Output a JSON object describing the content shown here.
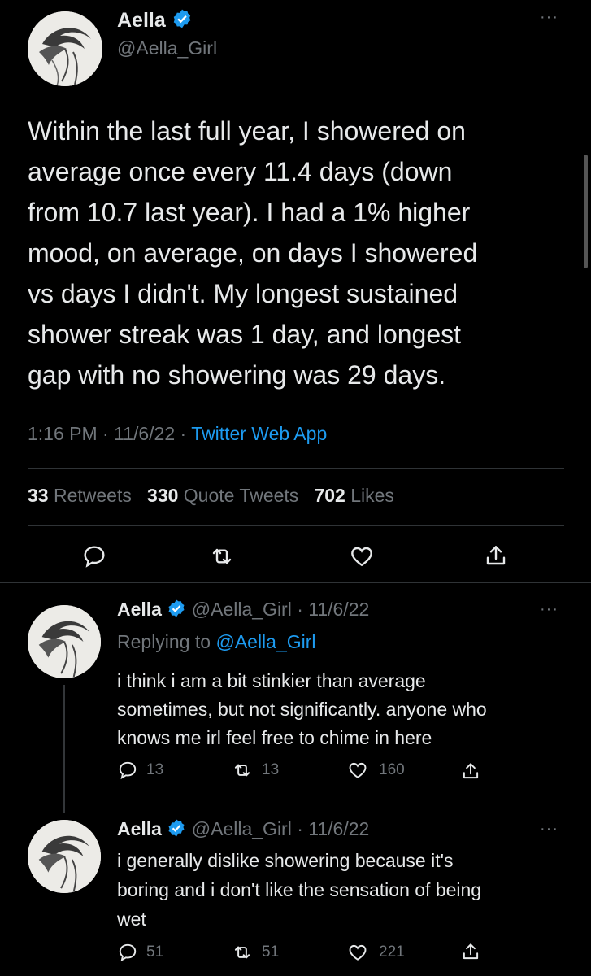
{
  "main_tweet": {
    "display_name": "Aella",
    "handle": "@Aella_Girl",
    "text_lines": [
      "Within the last full year, I showered on",
      "average once every 11.4 days (down",
      "from 10.7 last year). I had a 1% higher",
      "mood, on average, on days I showered",
      "vs days I didn't. My longest sustained",
      "shower streak was 1 day, and longest",
      "gap with no showering was 29 days."
    ],
    "time": "1:16 PM",
    "date": "11/6/22",
    "source": "Twitter Web App",
    "separator": "·",
    "stats": {
      "retweets_count": "33",
      "retweets_label": "Retweets",
      "quotes_count": "330",
      "quotes_label": "Quote Tweets",
      "likes_count": "702",
      "likes_label": "Likes"
    }
  },
  "replies": [
    {
      "display_name": "Aella",
      "handle": "@Aella_Girl",
      "date": "· 11/6/22",
      "replying_prefix": "Replying to",
      "replying_handle": "@Aella_Girl",
      "text_lines": [
        "i think i am a bit stinkier than average",
        "sometimes, but not significantly. anyone who",
        "knows me irl feel free to chime in here"
      ],
      "replies": "13",
      "retweets": "13",
      "likes": "160"
    },
    {
      "display_name": "Aella",
      "handle": "@Aella_Girl",
      "date": "· 11/6/22",
      "text_lines": [
        "i generally dislike showering because it's",
        "boring and i don't like the sensation of being",
        "wet"
      ],
      "replies": "51",
      "retweets": "51",
      "likes": "221"
    }
  ],
  "more_label": "···",
  "colors": {
    "background": "#000000",
    "text": "#e7e9ea",
    "muted": "#71767b",
    "link": "#1d9bf0",
    "verified": "#1d9bf0",
    "divider": "#2f3336"
  }
}
